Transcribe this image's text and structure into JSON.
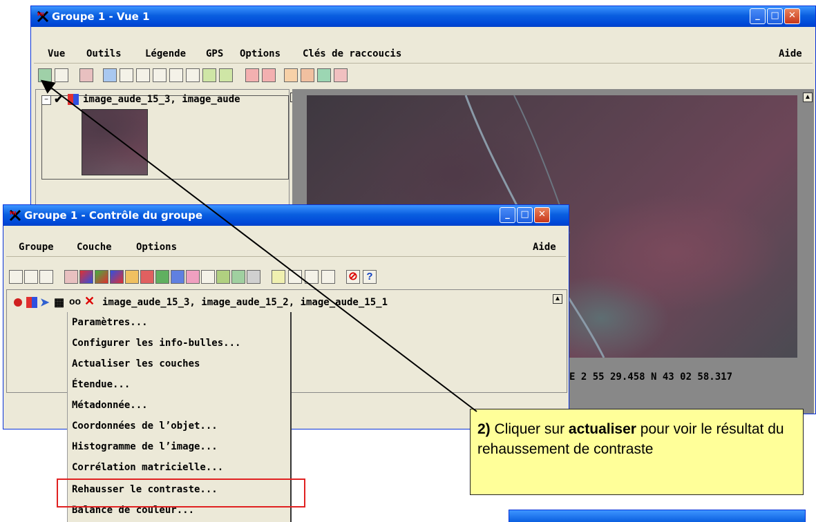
{
  "view_window": {
    "title": "Groupe 1 - Vue 1",
    "menu": [
      "Vue",
      "Outils",
      "Légende",
      "GPS",
      "Options",
      "Clés de raccoucis"
    ],
    "help": "Aide",
    "layer_label": "image_aude_15_3, image_aude",
    "coords": "E 2 55 29.458   N 43 02 58.317"
  },
  "group_window": {
    "title": "Groupe 1 - Contrôle du groupe",
    "menu": [
      "Groupe",
      "Couche",
      "Options"
    ],
    "help": "Aide",
    "layer_row": "image_aude_15_3, image_aude_15_2, image_aude_15_1"
  },
  "context_menu": {
    "items": [
      "Paramètres...",
      "Configurer les info-bulles...",
      "Actualiser les couches",
      "Étendue...",
      "Métadonnée...",
      "Coordonnées de l’objet...",
      "Histogramme de l’image...",
      "Corrélation matricielle...",
      "Rehausser le contraste...",
      "Balance de couleur..."
    ],
    "highlighted_index": 8,
    "highlight_color": "#e02020"
  },
  "callout": {
    "step": "2)",
    "text_before": " Cliquer sur ",
    "bold_word": "actualiser",
    "text_after": " pour voir le résultat du rehaussement de contraste",
    "background": "#ffff99"
  }
}
